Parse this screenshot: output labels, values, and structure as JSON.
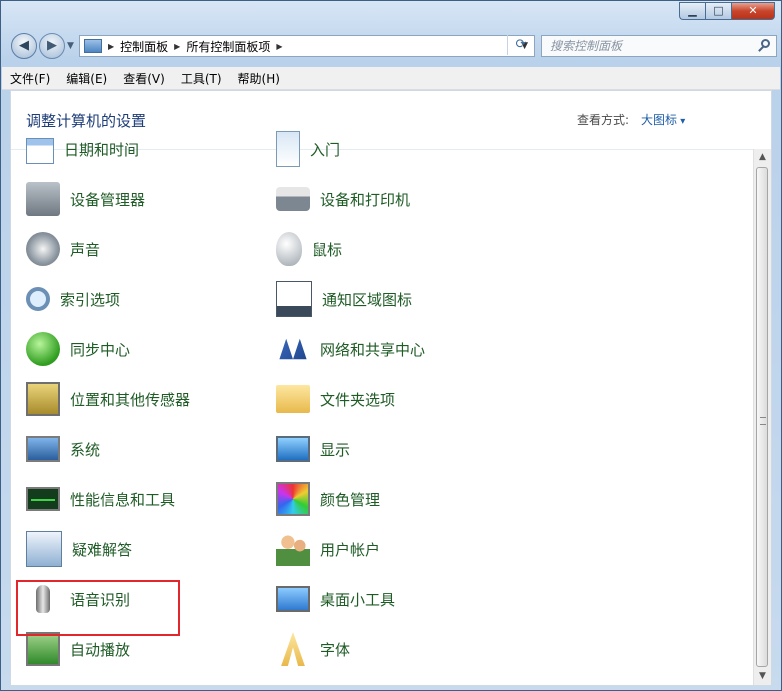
{
  "window": {
    "min_glyph": "▁",
    "max_glyph": "□",
    "close_glyph": "✕"
  },
  "address_bar": {
    "crumbs": [
      "控制面板",
      "所有控制面板项"
    ],
    "search_placeholder": "搜索控制面板"
  },
  "menu": {
    "items": [
      "文件(F)",
      "编辑(E)",
      "查看(V)",
      "工具(T)",
      "帮助(H)"
    ]
  },
  "header": {
    "title": "调整计算机的设置",
    "view_by_label": "查看方式:",
    "view_by_value": "大图标"
  },
  "items": [
    {
      "label": "日期和时间",
      "icon": "calendar-icon"
    },
    {
      "label": "入门",
      "icon": "getting-started-icon"
    },
    {
      "label": "设备管理器",
      "icon": "device-manager-icon"
    },
    {
      "label": "设备和打印机",
      "icon": "printer-icon"
    },
    {
      "label": "声音",
      "icon": "speaker-icon"
    },
    {
      "label": "鼠标",
      "icon": "mouse-icon"
    },
    {
      "label": "索引选项",
      "icon": "magnifier-icon"
    },
    {
      "label": "通知区域图标",
      "icon": "notification-tray-icon"
    },
    {
      "label": "同步中心",
      "icon": "sync-icon"
    },
    {
      "label": "网络和共享中心",
      "icon": "network-icon"
    },
    {
      "label": "位置和其他传感器",
      "icon": "sensor-icon"
    },
    {
      "label": "文件夹选项",
      "icon": "folder-icon"
    },
    {
      "label": "系统",
      "icon": "computer-icon"
    },
    {
      "label": "显示",
      "icon": "display-icon"
    },
    {
      "label": "性能信息和工具",
      "icon": "performance-icon"
    },
    {
      "label": "颜色管理",
      "icon": "color-icon"
    },
    {
      "label": "疑难解答",
      "icon": "troubleshoot-icon"
    },
    {
      "label": "用户帐户",
      "icon": "users-icon"
    },
    {
      "label": "语音识别",
      "icon": "microphone-icon"
    },
    {
      "label": "桌面小工具",
      "icon": "gadgets-icon"
    },
    {
      "label": "自动播放",
      "icon": "autoplay-icon"
    },
    {
      "label": "字体",
      "icon": "font-icon"
    }
  ],
  "highlight": {
    "item": "语音识别",
    "color": "#e2262b"
  },
  "colors": {
    "link_green": "#1e5b25",
    "heading_blue": "#1e3d78"
  }
}
